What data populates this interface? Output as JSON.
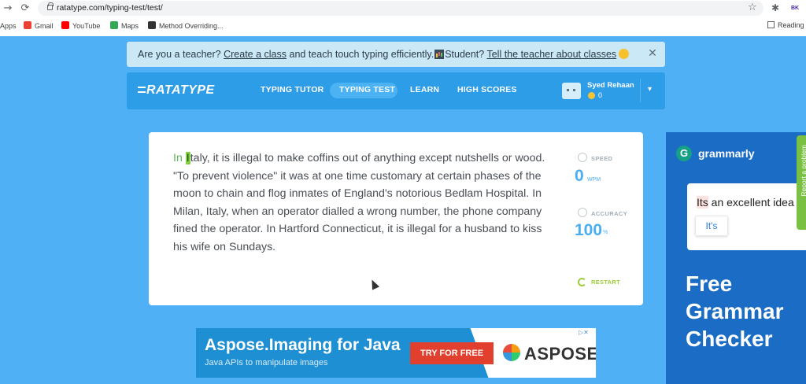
{
  "browser": {
    "url": "ratatype.com/typing-test/test/",
    "profile": "BK",
    "bookmarks": [
      {
        "label": "Apps",
        "color": ""
      },
      {
        "label": "Gmail",
        "color": "#ea4335"
      },
      {
        "label": "YouTube",
        "color": "#ff0000"
      },
      {
        "label": "Maps",
        "color": "#34a853"
      },
      {
        "label": "Method Overriding...",
        "color": "#333333"
      }
    ],
    "reading_list": "Reading"
  },
  "banner": {
    "prefix": "Are you a teacher?",
    "link1": "Create a class",
    "middle": "and teach touch typing efficiently.",
    "student": "Student?",
    "link2": "Tell the teacher about classes"
  },
  "nav": {
    "logo": "RATATYPE",
    "items": [
      "TYPING TUTOR",
      "TYPING TEST",
      "LEARN",
      "HIGH SCORES"
    ],
    "active": "TYPING TEST",
    "user": {
      "name": "Syed Rehaan",
      "coins": "0"
    }
  },
  "test": {
    "typed": "In ",
    "current_char": "I",
    "remaining": "taly, it is illegal to make coffins out of anything except nutshells or wood. \"To prevent violence\" it was at one time customary at certain phases of the moon to chain and flog inmates of England's notorious Bedlam Hospital. In Milan, Italy, when an operator dialled a wrong number, the phone company fined the operator. In Hartford Connecticut, it is illegal for a husband to kiss his wife on Sundays.",
    "speed_label": "SPEED",
    "speed_value": "0",
    "speed_unit": "WPM",
    "accuracy_label": "ACCURACY",
    "accuracy_value": "100",
    "accuracy_unit": "%",
    "restart": "RESTART"
  },
  "ad_aspose": {
    "title": "Aspose.Imaging for Java",
    "subtitle": "Java APIs to manipulate images",
    "cta": "TRY FOR FREE",
    "brand": "ASPOSE"
  },
  "ad_grammarly": {
    "brand": "grammarly",
    "sentence_highlight": "Its",
    "sentence_rest": " an excellent idea",
    "suggestion": "It's",
    "side_tab": "Report a problem",
    "headline": "Free Grammar Checker"
  },
  "colors": {
    "page_bg": "#4fb0f5",
    "nav_bg": "#2d9de8",
    "accent_blue": "#4aaef2",
    "typed_green": "#5cb85c",
    "restart_green": "#9ccc3a"
  }
}
